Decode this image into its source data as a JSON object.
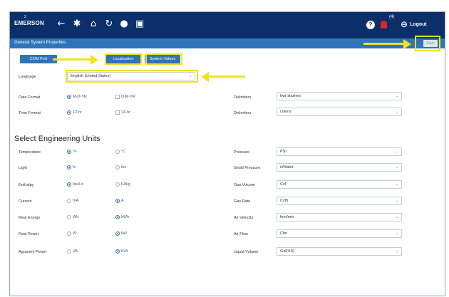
{
  "header": {
    "logo": "EMERSON",
    "logo_superscript": "2",
    "nav_icons": [
      "back-arrow-icon",
      "gear-icon",
      "home-icon",
      "refresh-icon",
      "globe-icon",
      "calendar-icon"
    ],
    "notification_count": "(4)",
    "logout_label": "Logout"
  },
  "titlebar": {
    "title": "General System Properties",
    "save_label": "Save"
  },
  "tabs": [
    {
      "label": "COM Port"
    },
    {
      "label": "Localization"
    },
    {
      "label": "System Values"
    }
  ],
  "language": {
    "label": "Language",
    "value": "English (United States)"
  },
  "date_format": {
    "label": "Date Format",
    "options": [
      "M-D-YR",
      "D-M-YR"
    ],
    "selected": 0
  },
  "time_format": {
    "label": "Time Format",
    "options": [
      "12-hr",
      "24-hr"
    ],
    "selected": 0
  },
  "delimiters": [
    {
      "label": "Delimiters",
      "value": "fwd-slashes"
    },
    {
      "label": "Delimiters",
      "value": "colons"
    }
  ],
  "units_title": "Select Engineering Units",
  "units_left": [
    {
      "label": "Temperature",
      "options": [
        "°F",
        "°C"
      ],
      "selected": 0
    },
    {
      "label": "Light",
      "options": [
        "fc",
        "lux"
      ],
      "selected": 0
    },
    {
      "label": "Enthalpy",
      "options": [
        "btu/Lb",
        "kJ/kg"
      ],
      "selected": 0
    },
    {
      "label": "Current",
      "options": [
        "mA",
        "A"
      ],
      "selected": 1
    },
    {
      "label": "Real Energy",
      "options": [
        "Wh",
        "kWh"
      ],
      "selected": 1
    },
    {
      "label": "Real Power",
      "options": [
        "W",
        "kW"
      ],
      "selected": 1
    },
    {
      "label": "Apparent Power",
      "options": [
        "VA",
        "kVA"
      ],
      "selected": 1
    }
  ],
  "units_right": [
    {
      "label": "Pressure",
      "value": "PSI"
    },
    {
      "label": "Small Pressure",
      "value": "inWater"
    },
    {
      "label": "Gas Volume",
      "value": "Ccf"
    },
    {
      "label": "Gas Rate",
      "value": "Ccfh"
    },
    {
      "label": "Air Velocity",
      "value": "feet/min"
    },
    {
      "label": "Air Flow",
      "value": "Cfm"
    },
    {
      "label": "Liquid Volume",
      "value": "Gal(US)"
    }
  ],
  "colors": {
    "nav": "#0b2f6a",
    "accent": "#2f74b9",
    "highlight": "#f1e21b"
  }
}
